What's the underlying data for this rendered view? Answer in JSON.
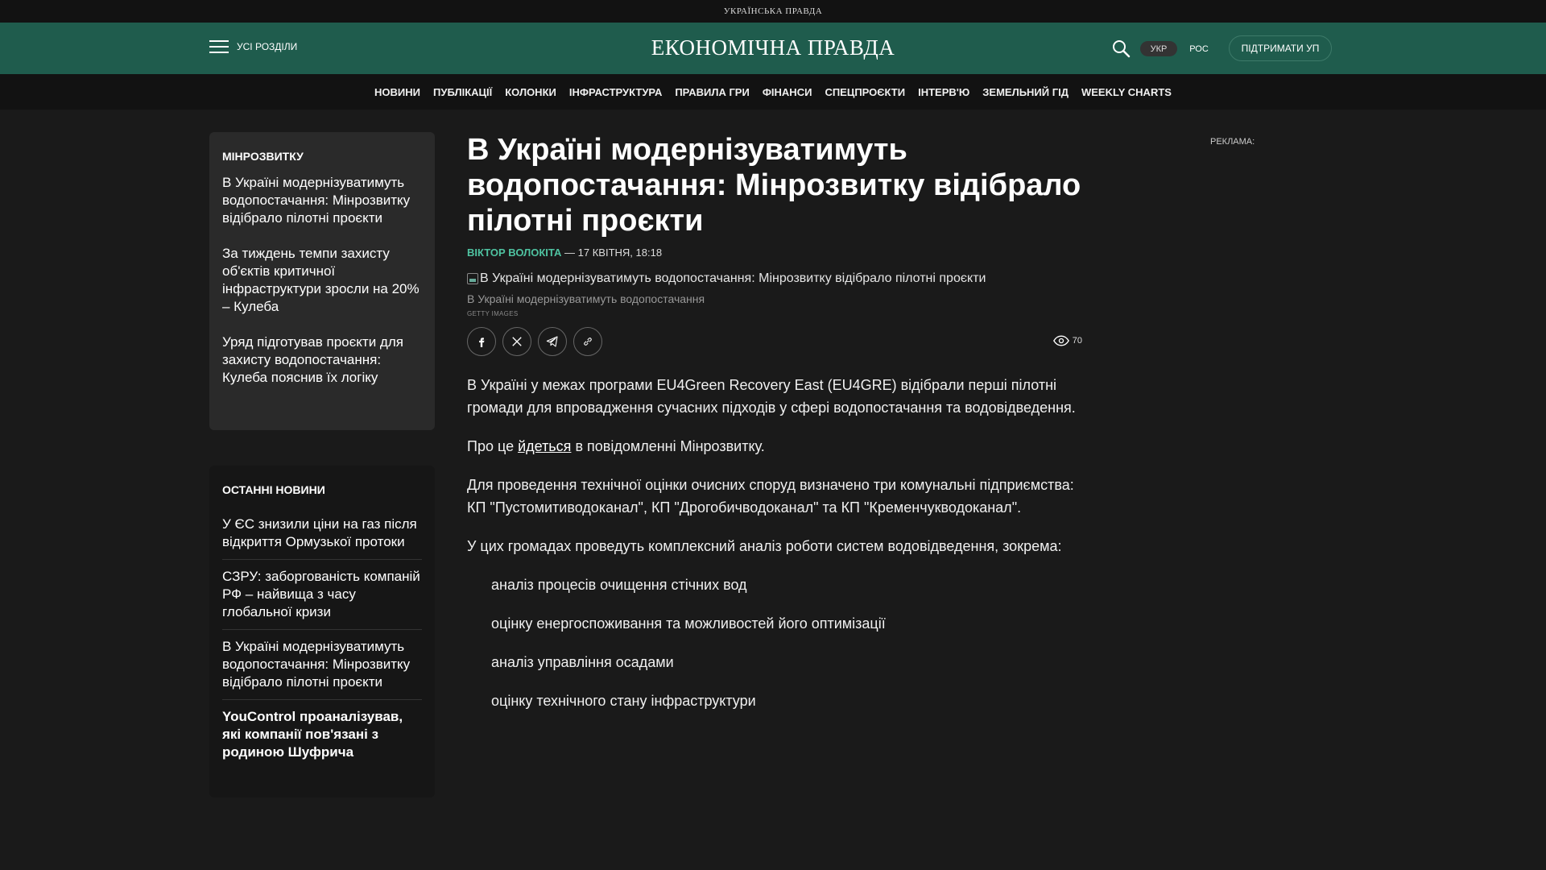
{
  "top_strip": {
    "brand": "УКРАЇНСЬКА ПРАВДА"
  },
  "header": {
    "menu_label": "УСІ РОЗДІЛИ",
    "logo": "ЕКОНОМІЧНА ПРАВДА",
    "lang_active": "УКР",
    "lang_other": "РОС",
    "support_label": "ПІДТРИМАТИ УП",
    "accent_color": "#1f5c4d"
  },
  "nav": {
    "items": [
      "НОВИНИ",
      "ПУБЛІКАЦІЇ",
      "КОЛОНКИ",
      "ІНФРАСТРУКТУРА",
      "ПРАВИЛА ГРИ",
      "ФІНАНСИ",
      "СПЕЦПРОЄКТИ",
      "ІНТЕРВ'Ю",
      "ЗЕМЕЛЬНИЙ ГІД",
      "WEEKLY CHARTS"
    ]
  },
  "sidebar_related": {
    "title": "МІНРОЗВИТКУ",
    "items": [
      "В Україні модернізуватимуть водопостачання: Мінрозвитку відібрало пілотні проєкти",
      "За тиждень темпи захисту об'єктів критичної інфраструктури зросли на 20% – Кулеба",
      "Уряд підготував проєкти для захисту водопостачання: Кулеба пояснив їх логіку"
    ]
  },
  "sidebar_latest": {
    "title": "ОСТАННІ НОВИНИ",
    "items": [
      "У ЄС знизили ціни на газ після відкриття Ормузької протоки",
      "СЗРУ: заборгованість компаній РФ – найвища з часу глобальної кризи",
      "В Україні модернізуватимуть водопостачання: Мінрозвитку відібрало пілотні проєкти",
      "YouControl проаналізував, які компанії пов'язані з родиною Шуфрича"
    ]
  },
  "article": {
    "headline": "В Україні модернізуватимуть водопостачання: Мінрозвитку відібрало пілотні проєкти",
    "author": "ВІКТОР ВОЛОКІТА",
    "date": " — 17 КВІТНЯ, 18:18",
    "image_alt": "В Україні модернізуватимуть водопостачання: Мінрозвитку відібрало пілотні проєкти",
    "caption": "В Україні модернізуватимуть водопостачання",
    "credit": "GETTY IMAGES",
    "views": "70",
    "p1": "В Україні у межах програми EU4Green Recovery East (EU4GRE) відібрали перші пілотні громади для впровадження сучасних підходів у сфері водопостачання та водовідведення.",
    "p2_before": "Про це ",
    "p2_link": "йдеться",
    "p2_after": " в повідомленні Мінрозвитку.",
    "p3": "Для проведення технічної оцінки очисних споруд визначено три комунальні підприємства: КП \"Пустомитиводоканал\", КП \"Дрогобичводоканал\" та КП \"Кременчукводоканал\".",
    "p4": "У цих громадах проведуть комплексний аналіз роботи систем водовідведення, зокрема:",
    "list": [
      "аналіз процесів очищення стічних вод",
      "оцінку енергоспоживання та можливостей його оптимізації",
      "аналіз управління осадами",
      "оцінку технічного стану інфраструктури"
    ]
  },
  "ad": {
    "label": "РЕКЛАМА:"
  }
}
